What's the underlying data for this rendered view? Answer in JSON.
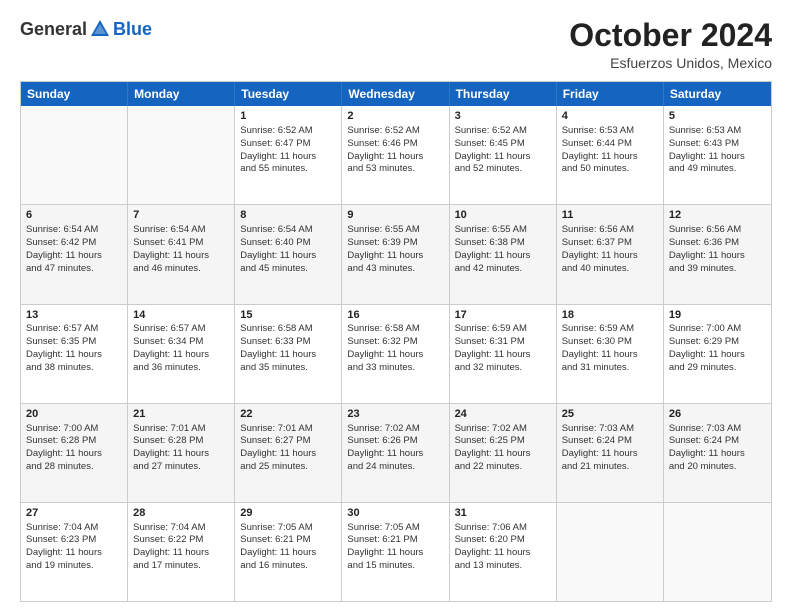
{
  "logo": {
    "general": "General",
    "blue": "Blue"
  },
  "header": {
    "month": "October 2024",
    "location": "Esfuerzos Unidos, Mexico"
  },
  "days": [
    "Sunday",
    "Monday",
    "Tuesday",
    "Wednesday",
    "Thursday",
    "Friday",
    "Saturday"
  ],
  "rows": [
    [
      {
        "num": "",
        "lines": []
      },
      {
        "num": "",
        "lines": []
      },
      {
        "num": "1",
        "lines": [
          "Sunrise: 6:52 AM",
          "Sunset: 6:47 PM",
          "Daylight: 11 hours",
          "and 55 minutes."
        ]
      },
      {
        "num": "2",
        "lines": [
          "Sunrise: 6:52 AM",
          "Sunset: 6:46 PM",
          "Daylight: 11 hours",
          "and 53 minutes."
        ]
      },
      {
        "num": "3",
        "lines": [
          "Sunrise: 6:52 AM",
          "Sunset: 6:45 PM",
          "Daylight: 11 hours",
          "and 52 minutes."
        ]
      },
      {
        "num": "4",
        "lines": [
          "Sunrise: 6:53 AM",
          "Sunset: 6:44 PM",
          "Daylight: 11 hours",
          "and 50 minutes."
        ]
      },
      {
        "num": "5",
        "lines": [
          "Sunrise: 6:53 AM",
          "Sunset: 6:43 PM",
          "Daylight: 11 hours",
          "and 49 minutes."
        ]
      }
    ],
    [
      {
        "num": "6",
        "lines": [
          "Sunrise: 6:54 AM",
          "Sunset: 6:42 PM",
          "Daylight: 11 hours",
          "and 47 minutes."
        ]
      },
      {
        "num": "7",
        "lines": [
          "Sunrise: 6:54 AM",
          "Sunset: 6:41 PM",
          "Daylight: 11 hours",
          "and 46 minutes."
        ]
      },
      {
        "num": "8",
        "lines": [
          "Sunrise: 6:54 AM",
          "Sunset: 6:40 PM",
          "Daylight: 11 hours",
          "and 45 minutes."
        ]
      },
      {
        "num": "9",
        "lines": [
          "Sunrise: 6:55 AM",
          "Sunset: 6:39 PM",
          "Daylight: 11 hours",
          "and 43 minutes."
        ]
      },
      {
        "num": "10",
        "lines": [
          "Sunrise: 6:55 AM",
          "Sunset: 6:38 PM",
          "Daylight: 11 hours",
          "and 42 minutes."
        ]
      },
      {
        "num": "11",
        "lines": [
          "Sunrise: 6:56 AM",
          "Sunset: 6:37 PM",
          "Daylight: 11 hours",
          "and 40 minutes."
        ]
      },
      {
        "num": "12",
        "lines": [
          "Sunrise: 6:56 AM",
          "Sunset: 6:36 PM",
          "Daylight: 11 hours",
          "and 39 minutes."
        ]
      }
    ],
    [
      {
        "num": "13",
        "lines": [
          "Sunrise: 6:57 AM",
          "Sunset: 6:35 PM",
          "Daylight: 11 hours",
          "and 38 minutes."
        ]
      },
      {
        "num": "14",
        "lines": [
          "Sunrise: 6:57 AM",
          "Sunset: 6:34 PM",
          "Daylight: 11 hours",
          "and 36 minutes."
        ]
      },
      {
        "num": "15",
        "lines": [
          "Sunrise: 6:58 AM",
          "Sunset: 6:33 PM",
          "Daylight: 11 hours",
          "and 35 minutes."
        ]
      },
      {
        "num": "16",
        "lines": [
          "Sunrise: 6:58 AM",
          "Sunset: 6:32 PM",
          "Daylight: 11 hours",
          "and 33 minutes."
        ]
      },
      {
        "num": "17",
        "lines": [
          "Sunrise: 6:59 AM",
          "Sunset: 6:31 PM",
          "Daylight: 11 hours",
          "and 32 minutes."
        ]
      },
      {
        "num": "18",
        "lines": [
          "Sunrise: 6:59 AM",
          "Sunset: 6:30 PM",
          "Daylight: 11 hours",
          "and 31 minutes."
        ]
      },
      {
        "num": "19",
        "lines": [
          "Sunrise: 7:00 AM",
          "Sunset: 6:29 PM",
          "Daylight: 11 hours",
          "and 29 minutes."
        ]
      }
    ],
    [
      {
        "num": "20",
        "lines": [
          "Sunrise: 7:00 AM",
          "Sunset: 6:28 PM",
          "Daylight: 11 hours",
          "and 28 minutes."
        ]
      },
      {
        "num": "21",
        "lines": [
          "Sunrise: 7:01 AM",
          "Sunset: 6:28 PM",
          "Daylight: 11 hours",
          "and 27 minutes."
        ]
      },
      {
        "num": "22",
        "lines": [
          "Sunrise: 7:01 AM",
          "Sunset: 6:27 PM",
          "Daylight: 11 hours",
          "and 25 minutes."
        ]
      },
      {
        "num": "23",
        "lines": [
          "Sunrise: 7:02 AM",
          "Sunset: 6:26 PM",
          "Daylight: 11 hours",
          "and 24 minutes."
        ]
      },
      {
        "num": "24",
        "lines": [
          "Sunrise: 7:02 AM",
          "Sunset: 6:25 PM",
          "Daylight: 11 hours",
          "and 22 minutes."
        ]
      },
      {
        "num": "25",
        "lines": [
          "Sunrise: 7:03 AM",
          "Sunset: 6:24 PM",
          "Daylight: 11 hours",
          "and 21 minutes."
        ]
      },
      {
        "num": "26",
        "lines": [
          "Sunrise: 7:03 AM",
          "Sunset: 6:24 PM",
          "Daylight: 11 hours",
          "and 20 minutes."
        ]
      }
    ],
    [
      {
        "num": "27",
        "lines": [
          "Sunrise: 7:04 AM",
          "Sunset: 6:23 PM",
          "Daylight: 11 hours",
          "and 19 minutes."
        ]
      },
      {
        "num": "28",
        "lines": [
          "Sunrise: 7:04 AM",
          "Sunset: 6:22 PM",
          "Daylight: 11 hours",
          "and 17 minutes."
        ]
      },
      {
        "num": "29",
        "lines": [
          "Sunrise: 7:05 AM",
          "Sunset: 6:21 PM",
          "Daylight: 11 hours",
          "and 16 minutes."
        ]
      },
      {
        "num": "30",
        "lines": [
          "Sunrise: 7:05 AM",
          "Sunset: 6:21 PM",
          "Daylight: 11 hours",
          "and 15 minutes."
        ]
      },
      {
        "num": "31",
        "lines": [
          "Sunrise: 7:06 AM",
          "Sunset: 6:20 PM",
          "Daylight: 11 hours",
          "and 13 minutes."
        ]
      },
      {
        "num": "",
        "lines": []
      },
      {
        "num": "",
        "lines": []
      }
    ]
  ]
}
